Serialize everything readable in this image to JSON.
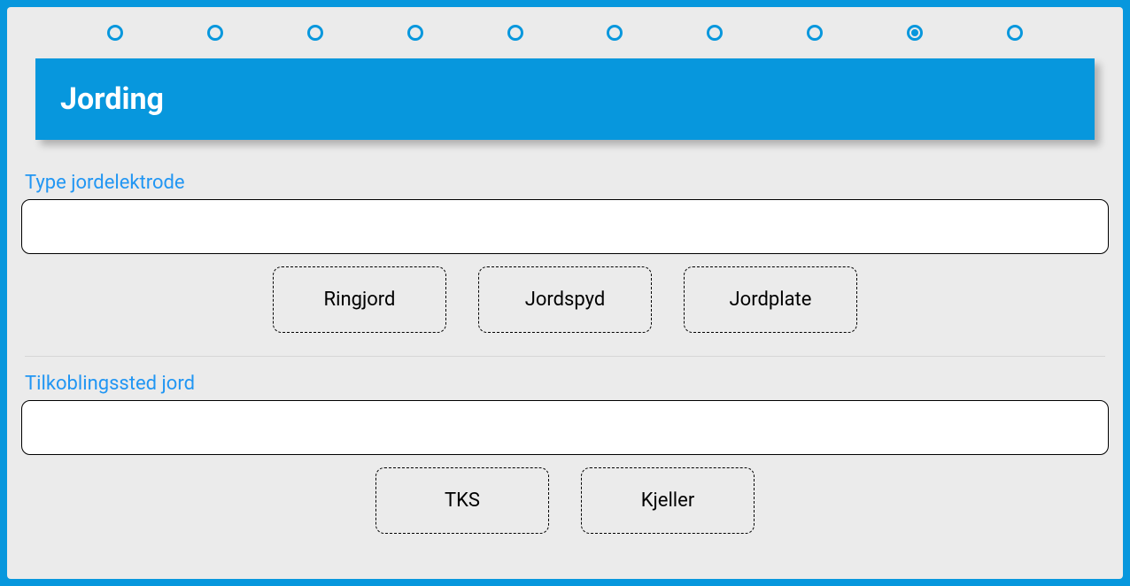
{
  "stepper": {
    "total": 10,
    "selectedIndex": 8
  },
  "header": {
    "title": "Jording"
  },
  "fields": {
    "type_elektrode": {
      "label": "Type jordelektrode",
      "value": "",
      "options": [
        "Ringjord",
        "Jordspyd",
        "Jordplate"
      ]
    },
    "tilkoblingssted": {
      "label": "Tilkoblingssted jord",
      "value": "",
      "options": [
        "TKS",
        "Kjeller"
      ]
    }
  }
}
